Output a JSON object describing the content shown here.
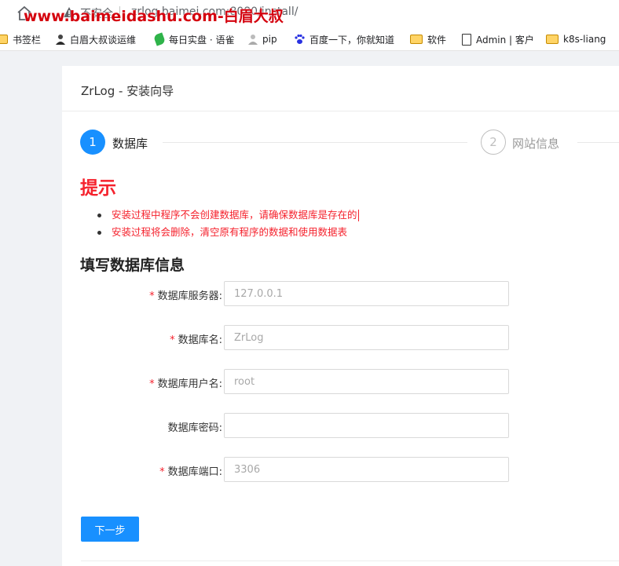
{
  "browser": {
    "insecure_label": "不安全",
    "url": "zrlog.baimei.com:8080/install/",
    "watermark": "www.baimeidashu.com-白眉大叔"
  },
  "bookmarks": [
    {
      "label": "书签栏",
      "icon": "folder-icon"
    },
    {
      "label": "白眉大叔谈运维",
      "icon": "person-icon"
    },
    {
      "label": "每日实盘 · 语雀",
      "icon": "leaf-icon"
    },
    {
      "label": "pip",
      "icon": "person-icon"
    },
    {
      "label": "百度一下，你就知道",
      "icon": "baidu-paw-icon"
    },
    {
      "label": "软件",
      "icon": "folder-icon"
    },
    {
      "label": "Admin | 客户",
      "icon": "document-icon"
    },
    {
      "label": "k8s-liang",
      "icon": "folder-icon"
    }
  ],
  "header": {
    "brand": "ZrLog - 安装向导"
  },
  "steps": [
    {
      "number": "1",
      "label": "数据库",
      "active": true
    },
    {
      "number": "2",
      "label": "网站信息",
      "active": false
    }
  ],
  "tips": {
    "title": "提示",
    "items": [
      "安装过程中程序不会创建数据库，请确保数据库是存在的",
      "安装过程将会删除，清空原有程序的数据和使用数据表"
    ]
  },
  "form": {
    "title": "填写数据库信息",
    "fields": [
      {
        "label": "数据库服务器:",
        "required": true,
        "placeholder": "127.0.0.1",
        "value": ""
      },
      {
        "label": "数据库名:",
        "required": true,
        "placeholder": "ZrLog",
        "value": ""
      },
      {
        "label": "数据库用户名:",
        "required": true,
        "placeholder": "root",
        "value": ""
      },
      {
        "label": "数据库密码:",
        "required": false,
        "placeholder": "",
        "value": ""
      },
      {
        "label": "数据库端口:",
        "required": true,
        "placeholder": "3306",
        "value": ""
      }
    ],
    "next_label": "下一步"
  },
  "colors": {
    "primary": "#1890ff",
    "danger": "#f5222d",
    "watermark": "#d4000d"
  }
}
